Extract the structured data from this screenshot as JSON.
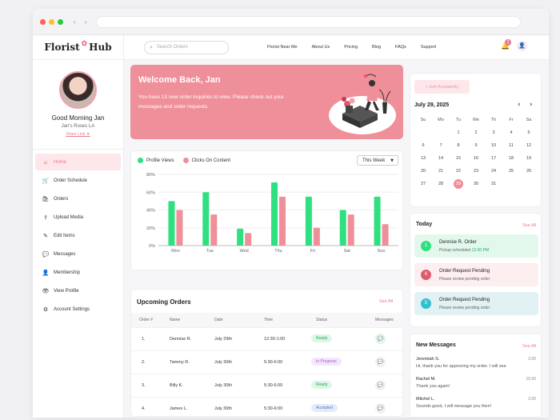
{
  "brand": {
    "name_left": "Florist",
    "name_right": "Hub"
  },
  "profile": {
    "greeting": "Good Morning Jan",
    "shop": "Jan's Roses LA",
    "share": "Share Link ▼"
  },
  "sidebar": {
    "items": [
      {
        "label": "Home",
        "icon": "home-icon",
        "glyph": "⌂"
      },
      {
        "label": "Order Schedule",
        "icon": "cart-icon",
        "glyph": "🛒"
      },
      {
        "label": "Orders",
        "icon": "bag-icon",
        "glyph": "🛍"
      },
      {
        "label": "Upload Media",
        "icon": "upload-icon",
        "glyph": "⇪"
      },
      {
        "label": "Edit Items",
        "icon": "edit-icon",
        "glyph": "✎"
      },
      {
        "label": "Messages",
        "icon": "chat-icon",
        "glyph": "💬"
      },
      {
        "label": "Membership",
        "icon": "user-icon",
        "glyph": "👤"
      },
      {
        "label": "View Profile",
        "icon": "eye-icon",
        "glyph": "👁"
      },
      {
        "label": "Account Settings",
        "icon": "gear-icon",
        "glyph": "⚙"
      }
    ]
  },
  "search": {
    "placeholder": "Search Orders"
  },
  "nav": {
    "links": [
      "Florist Near Me",
      "About Us",
      "Pricing",
      "Blog",
      "FAQs",
      "Support"
    ],
    "badge": "2"
  },
  "welcome": {
    "title": "Welcome Back, Jan",
    "text": "You have 13 new order inquiries to view. Please check out your messages and order requests."
  },
  "chart_data": {
    "type": "bar",
    "categories": [
      "Mon",
      "Tue",
      "Wed",
      "Thu",
      "Fri",
      "Sat",
      "Sun"
    ],
    "series": [
      {
        "name": "Profile Views",
        "color": "#2ee07f",
        "values": [
          50,
          60,
          19,
          71,
          55,
          40,
          55
        ]
      },
      {
        "name": "Clicks On Content",
        "color": "#ef8f99",
        "values": [
          40,
          35,
          14,
          55,
          20,
          35,
          24
        ]
      }
    ],
    "yticks": [
      "0%",
      "20%",
      "40%",
      "60%",
      "80%"
    ],
    "ylim": [
      0,
      80
    ],
    "grid": true,
    "legend": "top-left"
  },
  "chart_filter": "This Week",
  "orders": {
    "title": "Upcoming Orders",
    "see_all": "See All",
    "columns": [
      "Order #",
      "Name",
      "Date",
      "Time",
      "Status",
      "Messages"
    ],
    "rows": [
      {
        "num": "1.",
        "name": "Dennise R.",
        "date": "July 29th",
        "time": "12:30-1:00",
        "status": "Ready",
        "kind": "ready",
        "msg_green": true
      },
      {
        "num": "2.",
        "name": "Tammy R.",
        "date": "July 30th",
        "time": "5:30-6:00",
        "status": "In Progress",
        "kind": "prog",
        "msg_green": false
      },
      {
        "num": "3.",
        "name": "Billy K.",
        "date": "July 30th",
        "time": "5:30-6:00",
        "status": "Ready",
        "kind": "ready",
        "msg_green": false
      },
      {
        "num": "4.",
        "name": "James L.",
        "date": "July 30th",
        "time": "5:30-6:00",
        "status": "Accepted",
        "kind": "acc",
        "msg_green": false
      }
    ]
  },
  "calendar": {
    "edit_label": "+ Edit Availability",
    "month": "July 29, 2025",
    "weekdays": [
      "Su",
      "Mo",
      "Tu",
      "We",
      "Th",
      "Fr",
      "Sa"
    ],
    "first_weekday": 2,
    "days": 31,
    "today": 29
  },
  "today": {
    "title": "Today",
    "see_all": "See All",
    "events": [
      {
        "n": "1",
        "title": "Dennise R. Order",
        "sub": "Pickup scheduled",
        "time": "12:30 PM",
        "bg": "#e3f8ec",
        "dot": "#2ee07f"
      },
      {
        "n": "6",
        "title": "Order Request Pending",
        "sub": "Please review pending order",
        "time": "",
        "bg": "#fdeef0",
        "dot": "#e0596b"
      },
      {
        "n": "5",
        "title": "Order Request Pending",
        "sub": "Please review pending order",
        "time": "",
        "bg": "#e2f1f4",
        "dot": "#2fc0cf"
      }
    ]
  },
  "messages": {
    "title": "New Messages",
    "see_all": "See All",
    "items": [
      {
        "name": "Jeremiah S.",
        "text": "Hi, thank you for approving my order. I will see",
        "time": "2:00"
      },
      {
        "name": "Rachel M.",
        "text": "Thank you again!",
        "time": "10:30"
      },
      {
        "name": "Mitchel L.",
        "text": "Sounds good, I will message you then!",
        "time": "2:00"
      }
    ]
  }
}
